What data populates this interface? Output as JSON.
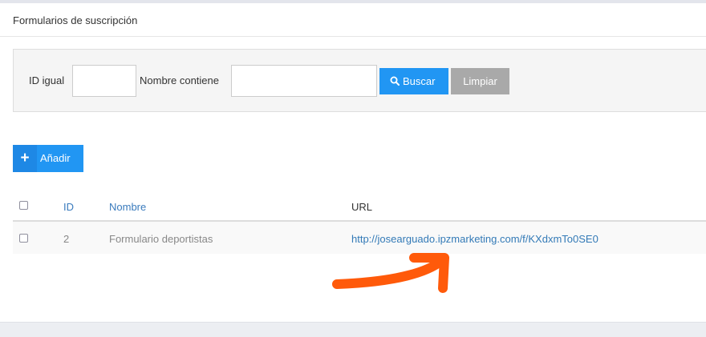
{
  "panel": {
    "title": "Formularios de suscripción"
  },
  "filters": {
    "id_label": "ID igual",
    "id_value": "",
    "name_label": "Nombre contiene",
    "name_value": "",
    "search_label": "Buscar",
    "clear_label": "Limpiar"
  },
  "toolbar": {
    "add_label": "Añadir"
  },
  "table": {
    "columns": {
      "id": "ID",
      "name": "Nombre",
      "url": "URL"
    },
    "rows": [
      {
        "id": "2",
        "name": "Formulario deportistas",
        "url": "http://josearguado.ipzmarketing.com/f/KXdxmTo0SE0"
      }
    ]
  },
  "colors": {
    "primary": "#2196f3",
    "clear_button": "#a9a9a9",
    "annotation_arrow": "#ff5a0a"
  }
}
